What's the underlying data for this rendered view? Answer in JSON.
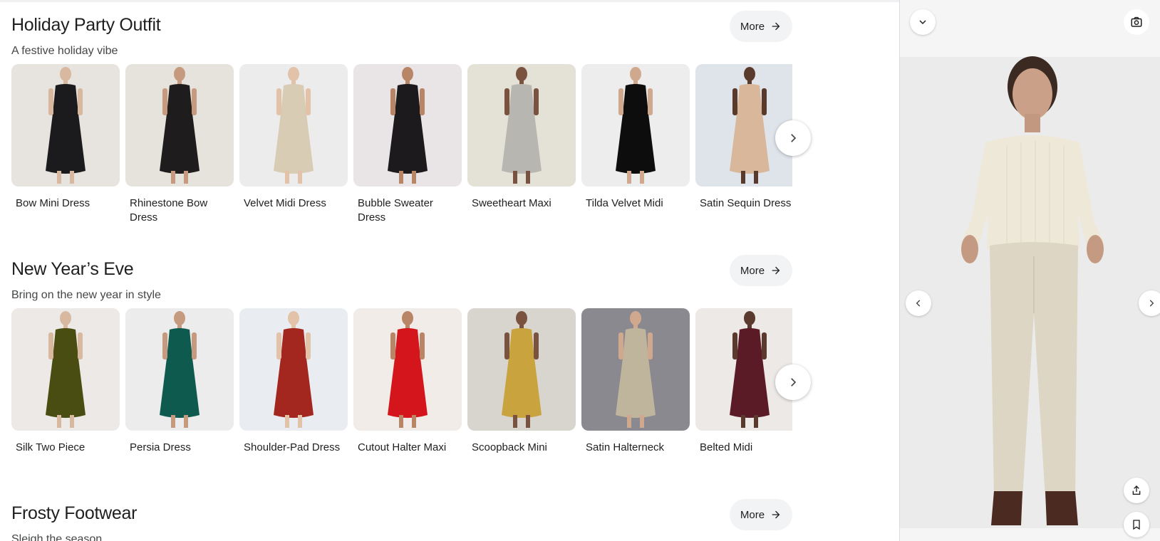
{
  "more_label": "More",
  "sections": [
    {
      "title": "Holiday Party Outfit",
      "subtitle": "A festive holiday vibe",
      "items": [
        {
          "label": "Bow Mini Dress"
        },
        {
          "label": "Rhinestone Bow Dress"
        },
        {
          "label": "Velvet Midi Dress"
        },
        {
          "label": "Bubble Sweater Dress"
        },
        {
          "label": "Sweetheart Maxi"
        },
        {
          "label": "Tilda Velvet Midi"
        },
        {
          "label": "Satin Sequin Dress"
        }
      ]
    },
    {
      "title": "New Year’s Eve",
      "subtitle": "Bring on the new year in style",
      "items": [
        {
          "label": "Silk Two Piece"
        },
        {
          "label": "Persia Dress"
        },
        {
          "label": "Shoulder-Pad Dress"
        },
        {
          "label": "Cutout Halter Maxi"
        },
        {
          "label": "Scoopback Mini"
        },
        {
          "label": "Satin Halterneck"
        },
        {
          "label": "Belted Midi"
        }
      ]
    },
    {
      "title": "Frosty Footwear",
      "subtitle": "Sleigh the season"
    }
  ],
  "colors": {
    "dresses_1": [
      "#1b1b1d",
      "#1e1c1c",
      "#d9ccb4",
      "#1c1a1c",
      "#b8b6b0",
      "#0d0d0d",
      "#d8b79a"
    ],
    "bgs_1": [
      "#e7e3df",
      "#e6e3dc",
      "#ececec",
      "#e9e4e6",
      "#e4e1d6",
      "#ededed",
      "#dfe4ea"
    ],
    "dresses_2": [
      "#4a4d12",
      "#0f5a4f",
      "#a3271f",
      "#d4161c",
      "#c9a33e",
      "#bfb59c",
      "#5a1a26"
    ],
    "bgs_2": [
      "#ece9e6",
      "#ececec",
      "#e9edf2",
      "#f1ece8",
      "#d8d4ce",
      "#8a8990",
      "#ece9e7"
    ],
    "skin": [
      "#d8b9a0",
      "#c59a7e",
      "#e2c2a8",
      "#b98567",
      "#7a5240",
      "#d0a88e",
      "#5a3a2c"
    ]
  },
  "icons": {
    "more_arrow": "arrow-right-icon",
    "next": "chevron-right-icon",
    "collapse": "chevron-down-icon",
    "camera": "camera-icon",
    "prev": "chevron-left-icon",
    "share": "share-icon",
    "save": "bookmark-icon"
  }
}
